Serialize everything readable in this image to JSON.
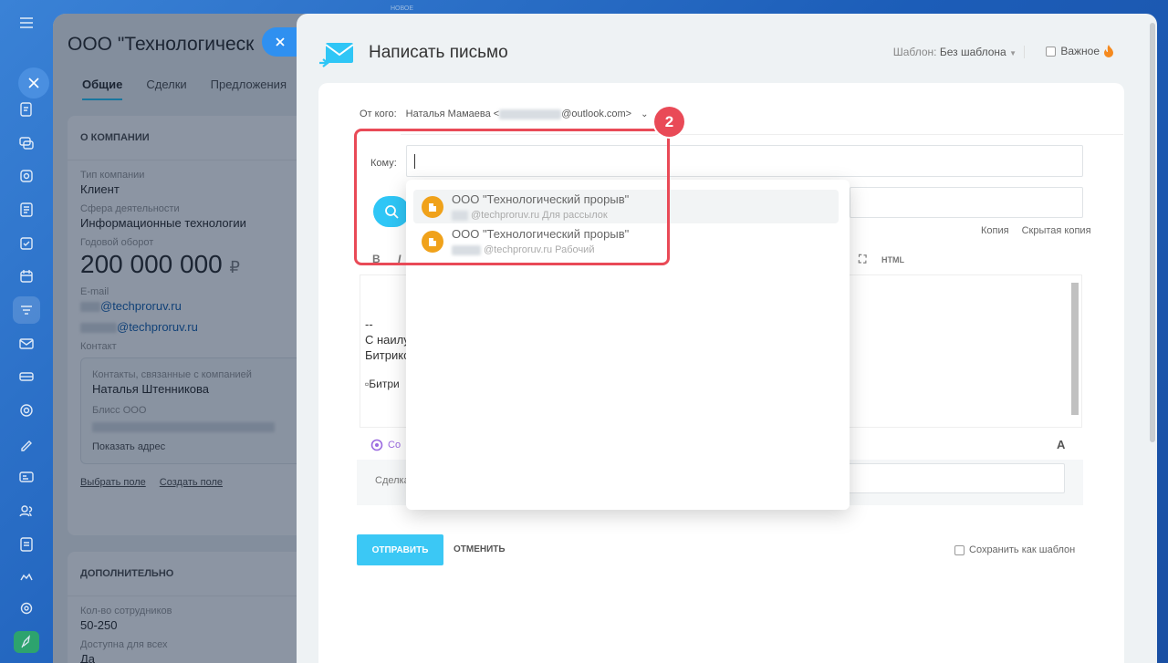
{
  "colors": {
    "accent": "#2fc6f6",
    "highlight": "#e94a57",
    "avatar": "#f0a21b",
    "copilot": "#9b6ae0"
  },
  "top_label": "НОВОЕ",
  "company": {
    "title": "ООО \"Технологическ",
    "tabs": [
      "Общие",
      "Сделки",
      "Предложения"
    ],
    "about_header": "О КОМПАНИИ",
    "type_label": "Тип компании",
    "type_value": "Клиент",
    "industry_label": "Сфера деятельности",
    "industry_value": "Информационные технологии",
    "revenue_label": "Годовой оборот",
    "revenue_value": "200 000 000",
    "currency": "₽",
    "email_label": "E-mail",
    "email1": "@techproruv.ru",
    "email2": "@techproruv.ru",
    "contact_label": "Контакт",
    "contacts_caption": "Контакты, связанные с компанией",
    "contact_name": "Наталья Штенникова",
    "contact_company": "Блисс ООО",
    "show_address": "Показать адрес",
    "select_field": "Выбрать поле",
    "create_field": "Создать поле",
    "extra_header": "ДОПОЛНИТЕЛЬНО",
    "employees_label": "Кол-во сотрудников",
    "employees_value": "50-250",
    "access_label": "Доступна для всех",
    "access_value": "Да"
  },
  "mail": {
    "title": "Написать письмо",
    "template_label": "Шаблон:",
    "template_value": "Без шаблона",
    "important_label": "Важное",
    "from_label": "От кого:",
    "from_name": "Наталья Мамаева <",
    "from_domain": "@outlook.com>",
    "to_label": "Кому:",
    "cc": "Копия",
    "bcc": "Скрытая копия",
    "fmt_bold": "B",
    "fmt_italic": "I",
    "html_label": "HTML",
    "sig_dash": "--",
    "sig_line1": "С наилу",
    "sig_line2": "Битрикс",
    "sig_img": "Битри",
    "copilot_label": "Co",
    "text_size_label": "A",
    "deal_label": "Сделка",
    "send_label": "ОТПРАВИТЬ",
    "cancel_label": "ОТМЕНИТЬ",
    "save_template_label": "Сохранить как шаблон"
  },
  "dropdown": {
    "items": [
      {
        "name": "ООО \"Технологический прорыв\"",
        "email": "@techproruv.ru",
        "tag": "Для рассылок"
      },
      {
        "name": "ООО \"Технологический прорыв\"",
        "email": "@techproruv.ru",
        "tag": "Рабочий"
      }
    ]
  },
  "badge_number": "2"
}
